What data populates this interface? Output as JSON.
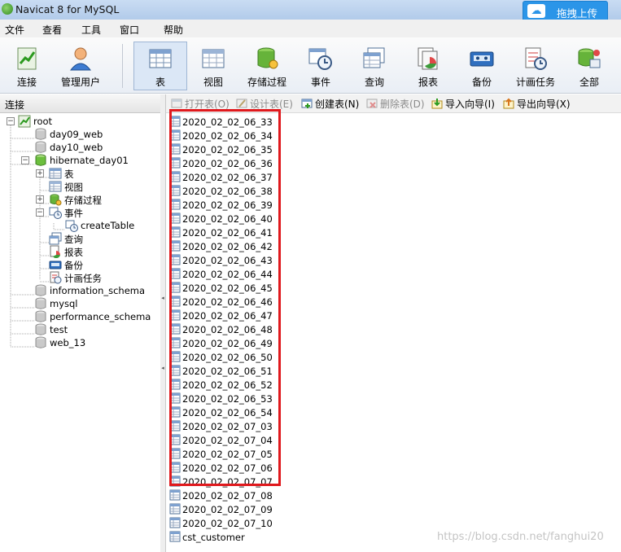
{
  "window": {
    "title": "Navicat 8 for MySQL",
    "upload_label": "拖拽上传"
  },
  "menu": [
    "文件",
    "查看",
    "工具",
    "窗口",
    "帮助"
  ],
  "toolbar": [
    "连接",
    "管理用户",
    "表",
    "视图",
    "存储过程",
    "事件",
    "查询",
    "报表",
    "备份",
    "计画任务",
    "全部"
  ],
  "toolbar_active": "表",
  "left_pane": {
    "header": "连接",
    "tree": [
      "root",
      "day09_web",
      "day10_web",
      "hibernate_day01",
      "表",
      "视图",
      "存储过程",
      "事件",
      "createTable",
      "查询",
      "报表",
      "备份",
      "计画任务",
      "information_schema",
      "mysql",
      "performance_schema",
      "test",
      "web_13"
    ]
  },
  "right_toolbar": [
    {
      "label": "打开表(O)",
      "enabled": false
    },
    {
      "label": "设计表(E)",
      "enabled": false
    },
    {
      "label": "创建表(N)",
      "enabled": true
    },
    {
      "label": "删除表(D)",
      "enabled": false
    },
    {
      "label": "导入向导(I)",
      "enabled": true
    },
    {
      "label": "导出向导(X)",
      "enabled": true
    }
  ],
  "tables": [
    "2020_02_02_06_33",
    "2020_02_02_06_34",
    "2020_02_02_06_35",
    "2020_02_02_06_36",
    "2020_02_02_06_37",
    "2020_02_02_06_38",
    "2020_02_02_06_39",
    "2020_02_02_06_40",
    "2020_02_02_06_41",
    "2020_02_02_06_42",
    "2020_02_02_06_43",
    "2020_02_02_06_44",
    "2020_02_02_06_45",
    "2020_02_02_06_46",
    "2020_02_02_06_47",
    "2020_02_02_06_48",
    "2020_02_02_06_49",
    "2020_02_02_06_50",
    "2020_02_02_06_51",
    "2020_02_02_06_52",
    "2020_02_02_06_53",
    "2020_02_02_06_54",
    "2020_02_02_07_03",
    "2020_02_02_07_04",
    "2020_02_02_07_05",
    "2020_02_02_07_06",
    "2020_02_02_07_07",
    "2020_02_02_07_08",
    "2020_02_02_07_09",
    "2020_02_02_07_10",
    "cst_customer"
  ],
  "highlight_color": "#e0191d",
  "watermark": "https://blog.csdn.net/fanghui20"
}
